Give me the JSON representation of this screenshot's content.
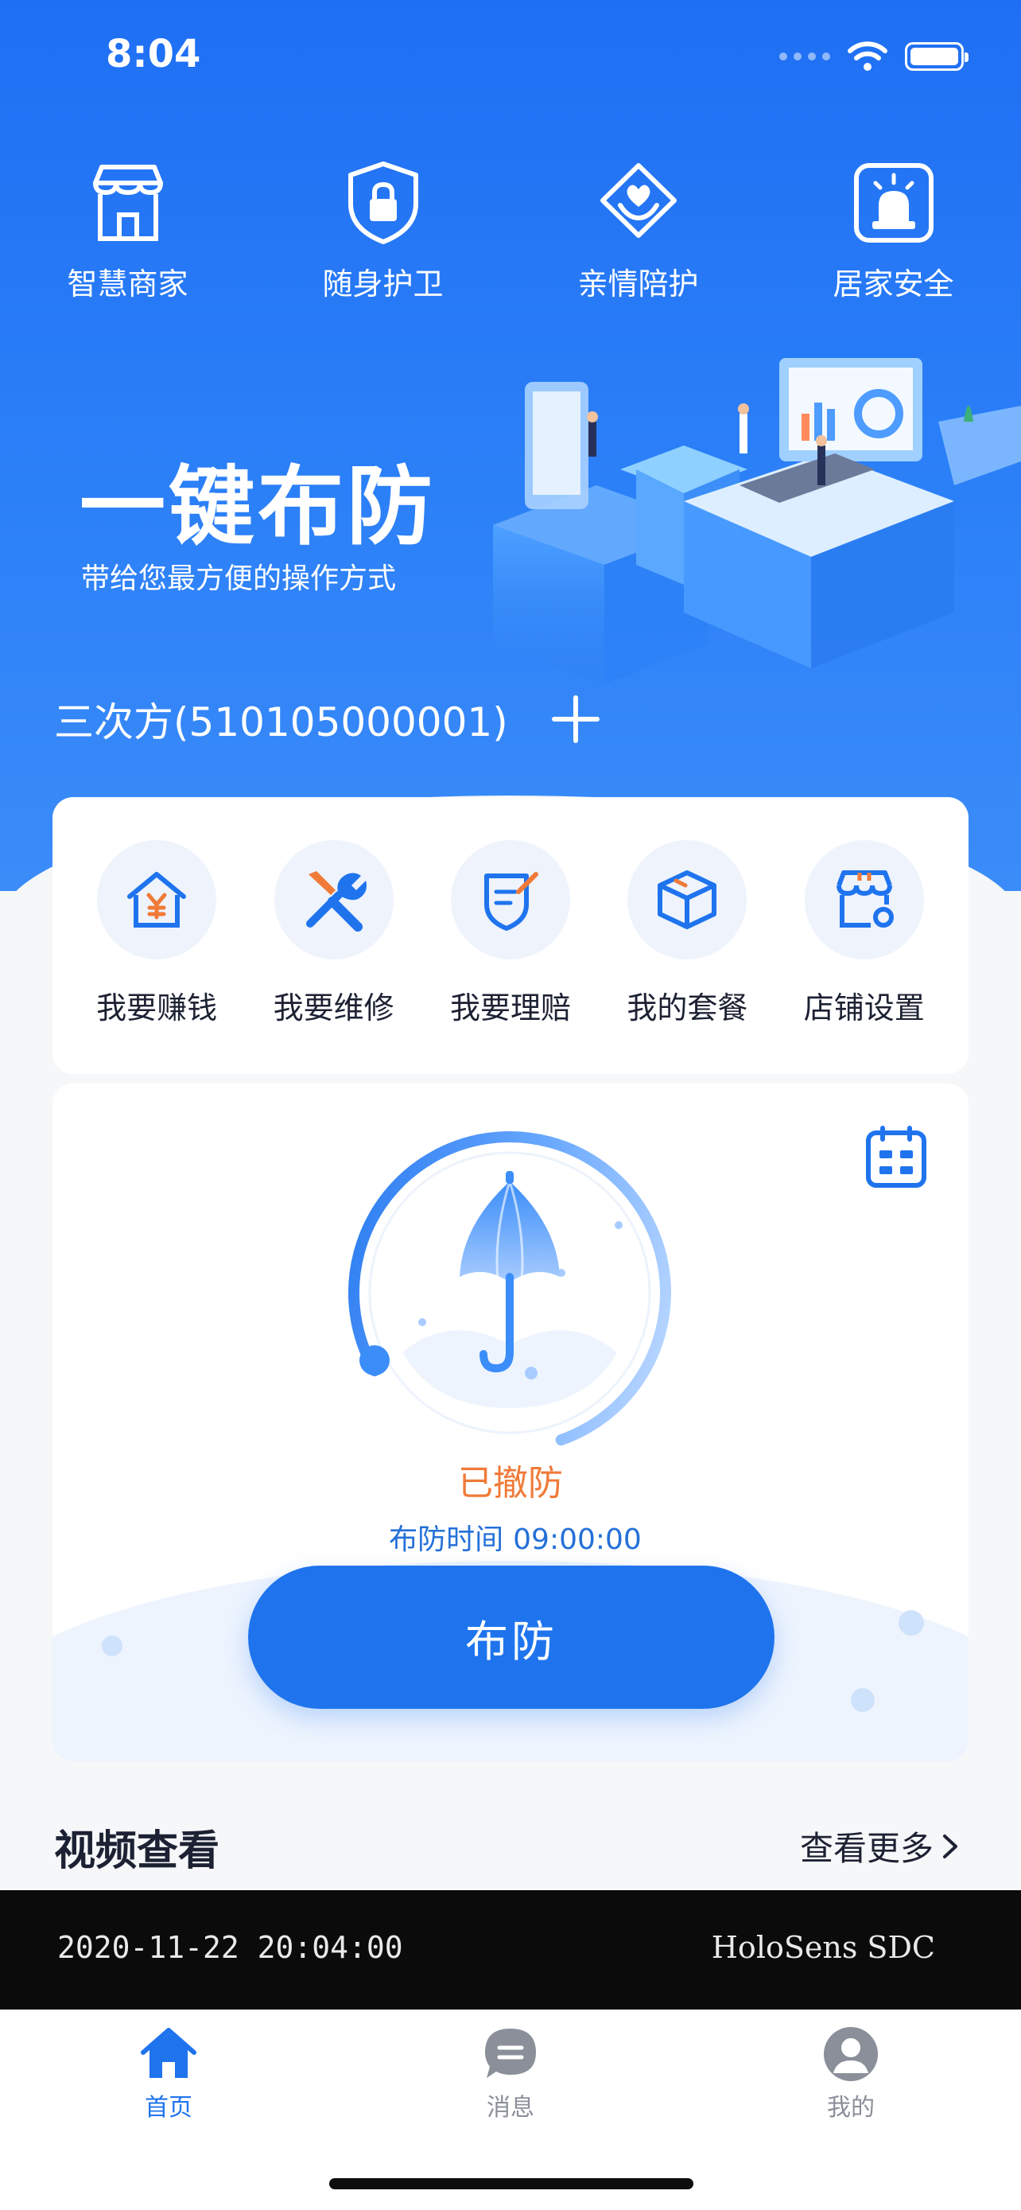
{
  "status_bar": {
    "time": "8:04"
  },
  "top_shortcuts": [
    {
      "label": "智慧商家",
      "icon": "store-icon"
    },
    {
      "label": "随身护卫",
      "icon": "shield-lock-icon"
    },
    {
      "label": "亲情陪护",
      "icon": "heart-hands-icon"
    },
    {
      "label": "居家安全",
      "icon": "alarm-light-icon"
    }
  ],
  "hero": {
    "title": "一键布防",
    "subtitle": "带给您最方便的操作方式"
  },
  "device": {
    "name": "三次方(510105000001)"
  },
  "services": [
    {
      "label": "我要赚钱",
      "icon": "money-house-icon"
    },
    {
      "label": "我要维修",
      "icon": "tools-icon"
    },
    {
      "label": "我要理赔",
      "icon": "claim-shield-icon"
    },
    {
      "label": "我的套餐",
      "icon": "package-box-icon"
    },
    {
      "label": "店铺设置",
      "icon": "shop-settings-icon"
    }
  ],
  "arm_panel": {
    "status": "已撤防",
    "time_label": "布防时间",
    "time_value": "09:00:00",
    "button_label": "布防"
  },
  "video": {
    "title": "视频查看",
    "more_label": "查看更多",
    "timestamp": "2020-11-22 20:04:00",
    "brand": "HoloSens SDC"
  },
  "tabs": [
    {
      "label": "首页",
      "icon": "home-icon",
      "active": true
    },
    {
      "label": "消息",
      "icon": "message-icon",
      "active": false
    },
    {
      "label": "我的",
      "icon": "profile-icon",
      "active": false
    }
  ],
  "colors": {
    "primary": "#1f74ee",
    "header": "#2c80f7",
    "disarmed": "#f07a38"
  }
}
